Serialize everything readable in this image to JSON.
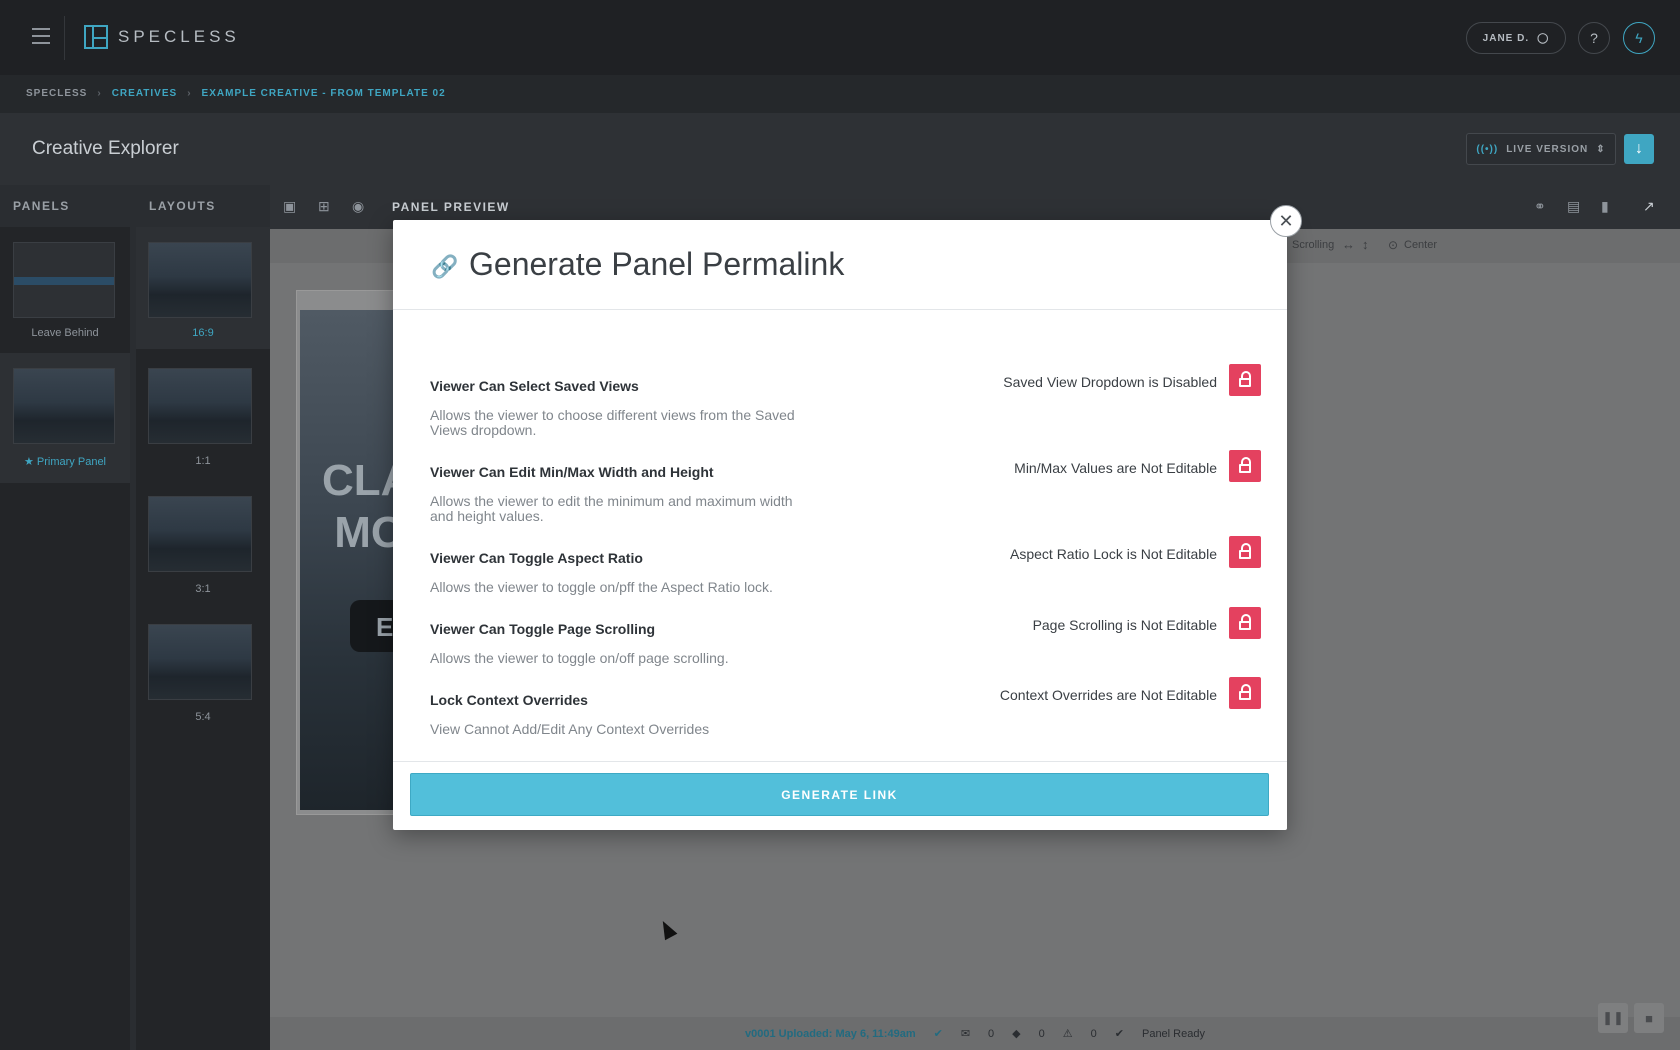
{
  "app": {
    "logo_text": "SPECLESS"
  },
  "header": {
    "user_label": "JANE D.",
    "help_icon": "question-icon",
    "power_icon": "lightning-icon"
  },
  "breadcrumb": [
    "SPECLESS",
    "CREATIVES",
    "EXAMPLE CREATIVE - FROM TEMPLATE 02"
  ],
  "page": {
    "title": "Creative Explorer",
    "version_label": "LIVE VERSION"
  },
  "panels": {
    "heading": "PANELS",
    "items": [
      {
        "label": "Leave Behind"
      },
      {
        "label": "Primary Panel"
      }
    ]
  },
  "layouts": {
    "heading": "LAYOUTS",
    "items": [
      {
        "label": "16:9"
      },
      {
        "label": "1:1"
      },
      {
        "label": "3:1"
      },
      {
        "label": "5:4"
      }
    ]
  },
  "preview": {
    "title": "PANEL PREVIEW",
    "scrolling_label": "Scrolling",
    "center_label": "Center",
    "frame_text": "CLA\nMO",
    "frame_btn": "E"
  },
  "modal": {
    "title": "Generate Panel Permalink",
    "options": [
      {
        "title": "Viewer Can Select Saved Views",
        "desc": "Allows the viewer to choose different views from the Saved Views dropdown.",
        "status": "Saved View Dropdown is Disabled"
      },
      {
        "title": "Viewer Can Edit Min/Max Width and Height",
        "desc": "Allows the viewer to edit the minimum and maximum width and height values.",
        "status": "Min/Max Values are Not Editable"
      },
      {
        "title": "Viewer Can Toggle Aspect Ratio",
        "desc": "Allows the viewer to toggle on/pff the Aspect Ratio lock.",
        "status": "Aspect Ratio Lock is Not Editable"
      },
      {
        "title": "Viewer Can Toggle Page Scrolling",
        "desc": "Allows the viewer to toggle on/off page scrolling.",
        "status": "Page Scrolling is Not Editable"
      },
      {
        "title": "Lock Context Overrides",
        "desc": "View Cannot Add/Edit Any Context Overrides",
        "status": "Context Overrides are Not Editable"
      }
    ],
    "generate_label": "GENERATE LINK"
  },
  "status": {
    "version": "v0001 Uploaded: May 6, 11:49am",
    "comments": "0",
    "diamonds": "0",
    "warnings": "0",
    "ready": "Panel Ready"
  },
  "colors": {
    "accent": "#3fa6c2",
    "lock_red": "#e4415f",
    "generate_blue": "#52bfda"
  }
}
